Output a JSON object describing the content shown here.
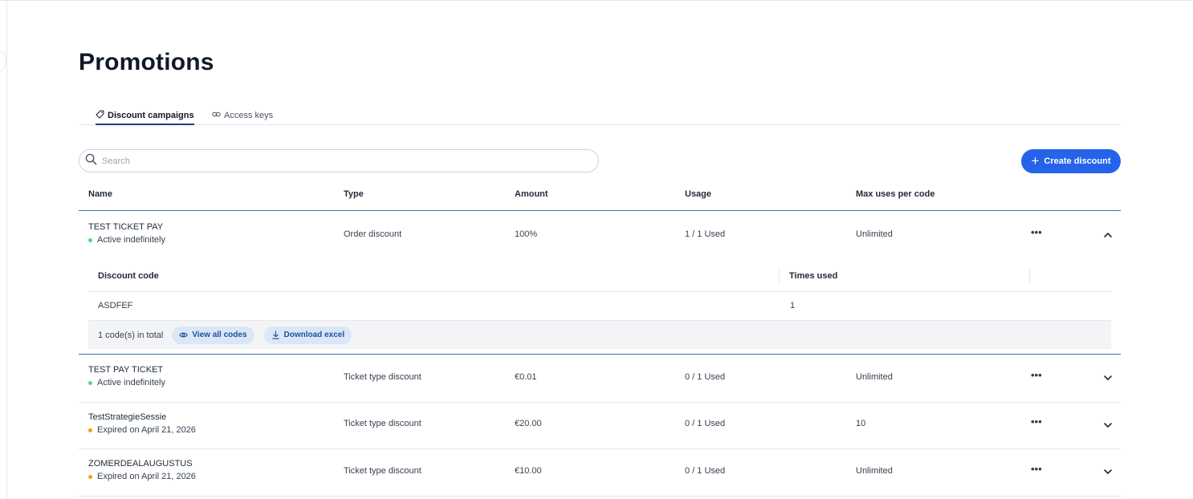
{
  "page": {
    "title": "Promotions"
  },
  "tabs": [
    {
      "label": "Discount campaigns",
      "icon": "tag-icon",
      "active": true
    },
    {
      "label": "Access keys",
      "icon": "link-icon",
      "active": false
    }
  ],
  "search": {
    "placeholder": "Search",
    "value": ""
  },
  "create_button": {
    "label": "Create discount"
  },
  "colors": {
    "accent": "#2563eb",
    "active_status": "#4ade80",
    "expired_status": "#f59e0b",
    "table_rule": "#3b6fb6"
  },
  "table": {
    "columns": [
      "Name",
      "Type",
      "Amount",
      "Usage",
      "Max uses per code"
    ],
    "rows": [
      {
        "name": "TEST TICKET PAY",
        "status": "Active indefinitely",
        "status_kind": "active",
        "type": "Order discount",
        "amount": "100%",
        "usage": "1 / 1 Used",
        "max_uses": "Unlimited",
        "expanded": true
      },
      {
        "name": "TEST PAY TICKET",
        "status": "Active indefinitely",
        "status_kind": "active",
        "type": "Ticket type discount",
        "amount": "€0.01",
        "usage": "0 / 1 Used",
        "max_uses": "Unlimited",
        "expanded": false
      },
      {
        "name": "TestStrategieSessie",
        "status": "Expired on April 21, 2026",
        "status_kind": "expired",
        "type": "Ticket type discount",
        "amount": "€20.00",
        "usage": "0 / 1 Used",
        "max_uses": "10",
        "expanded": false
      },
      {
        "name": "ZOMERDEALAUGUSTUS",
        "status": "Expired on April 21, 2026",
        "status_kind": "expired",
        "type": "Ticket type discount",
        "amount": "€10.00",
        "usage": "0 / 1 Used",
        "max_uses": "Unlimited",
        "expanded": false
      }
    ]
  },
  "codes_panel": {
    "columns": [
      "Discount code",
      "Times used"
    ],
    "rows": [
      {
        "code": "ASDFEF",
        "times_used": "1"
      }
    ],
    "total_text": "1 code(s) in total",
    "view_all_label": "View all codes",
    "download_label": "Download excel"
  },
  "row_actions": {
    "more_glyph": "•••"
  }
}
